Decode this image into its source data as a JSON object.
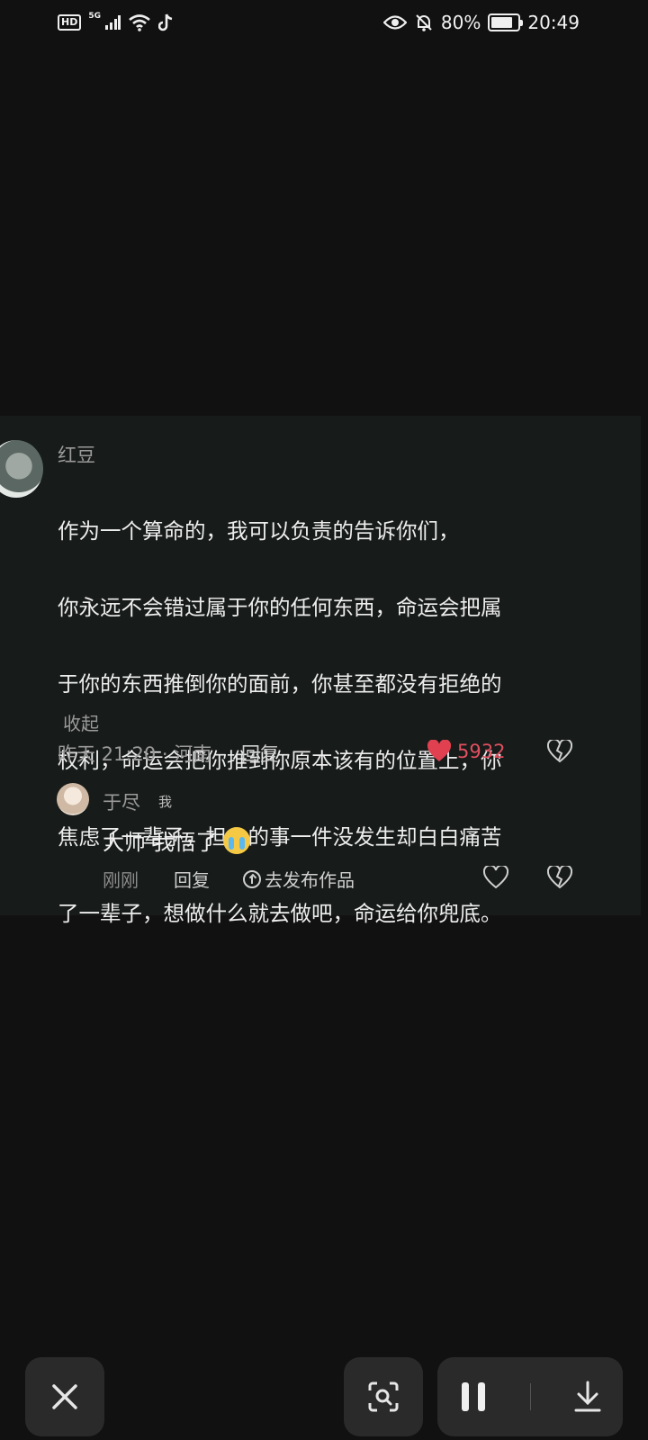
{
  "status_bar": {
    "hd": "HD",
    "network": "5G",
    "battery": "80%",
    "battery_level": 0.8,
    "time": "20:49"
  },
  "comment": {
    "author": "红豆",
    "lines": [
      "作为一个算命的，我可以负责的告诉你们，",
      "你永远不会错过属于你的任何东西，命运会把属",
      "于你的东西推倒你的面前，你甚至都没有拒绝的",
      "权利，命运会把你推到你原本该有的位置上，你",
      "焦虑了一辈子，担心的事一件没发生却白白痛苦",
      "了一辈子，想做什么就去做吧，命运给你兜底。"
    ],
    "collapse": "收起",
    "meta": "昨天 21:20 · 河南",
    "reply": "回复",
    "likes": "5932",
    "like_color": "#e0404f"
  },
  "reply": {
    "author": "于尽",
    "tag": "我",
    "text": "大师 我悟了",
    "emoji": "loudly-crying-face",
    "time": "刚刚",
    "reply": "回复",
    "publish": "去发布作品"
  },
  "toolbar": {
    "close": "close-icon",
    "scan": "scan-icon",
    "pause": "pause-icon",
    "download": "download-icon"
  }
}
